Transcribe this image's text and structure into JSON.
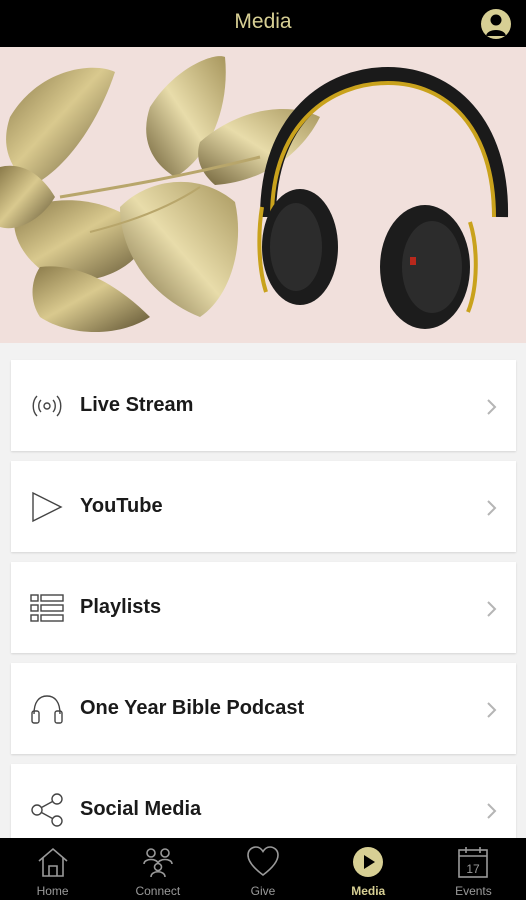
{
  "header": {
    "title": "Media",
    "profile_icon": "person-icon"
  },
  "hero": {
    "image": "gold-leaves-and-headphones"
  },
  "menu": [
    {
      "label": "Live Stream",
      "icon": "broadcast-icon"
    },
    {
      "label": "YouTube",
      "icon": "play-outline-icon"
    },
    {
      "label": "Playlists",
      "icon": "list-icon"
    },
    {
      "label": "One Year Bible Podcast",
      "icon": "headphones-icon"
    },
    {
      "label": "Social Media",
      "icon": "share-icon"
    }
  ],
  "tabbar": {
    "tabs": [
      {
        "label": "Home",
        "icon": "home-icon",
        "active": false
      },
      {
        "label": "Connect",
        "icon": "people-icon",
        "active": false
      },
      {
        "label": "Give",
        "icon": "heart-icon",
        "active": false
      },
      {
        "label": "Media",
        "icon": "play-circle-icon",
        "active": true
      },
      {
        "label": "Events",
        "icon": "calendar-icon",
        "active": false
      }
    ],
    "calendar_day": "17"
  },
  "colors": {
    "accent": "#d7cf94",
    "header_bg": "#000000",
    "background": "#f2f2f2"
  }
}
